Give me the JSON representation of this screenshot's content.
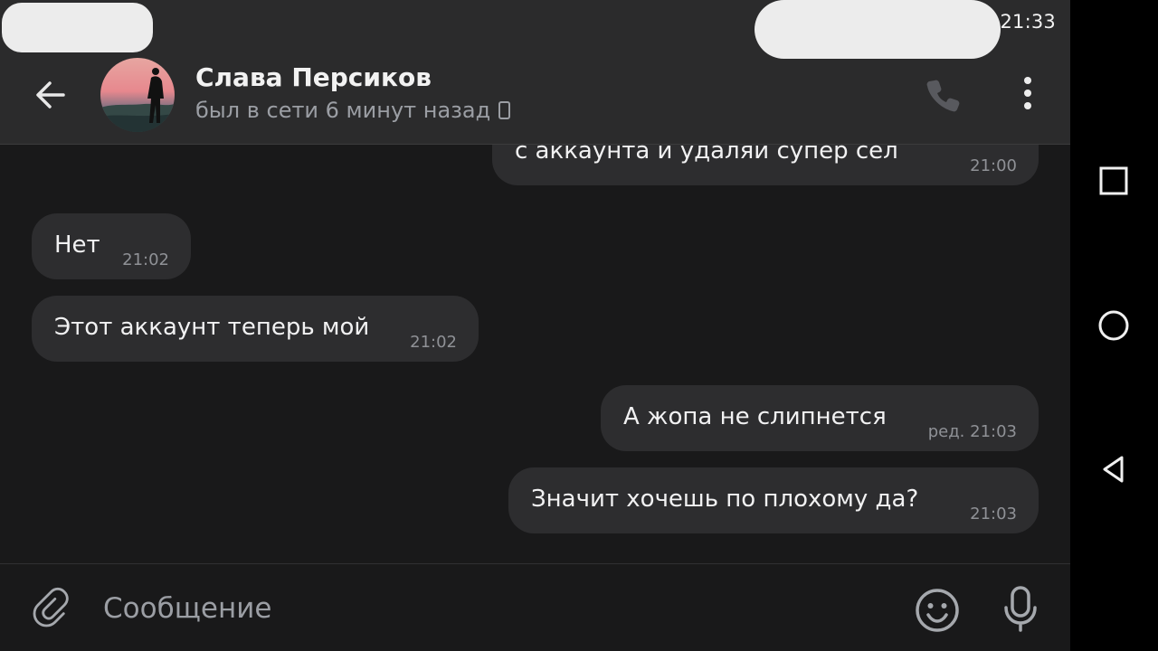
{
  "status_bar": {
    "time": "21:33"
  },
  "header": {
    "back_icon": "arrow-left-icon",
    "contact_name": "Слава Персиков",
    "last_seen": "был в сети 6 минут назад",
    "device_icon": "mobile-phone-icon",
    "call_icon": "phone-icon",
    "menu_icon": "more-vertical-icon"
  },
  "messages": [
    {
      "direction": "outgoing",
      "text": "с аккаунта и удаляй супер сел",
      "time": "21:00"
    },
    {
      "direction": "incoming",
      "text": "Нет",
      "time": "21:02"
    },
    {
      "direction": "incoming",
      "text": "Этот аккаунт теперь мой",
      "time": "21:02"
    },
    {
      "direction": "outgoing",
      "text": "А жопа не слипнется",
      "time": "ред. 21:03"
    },
    {
      "direction": "outgoing",
      "text": "Значит хочешь по плохому да?",
      "time": "21:03"
    }
  ],
  "composer": {
    "attach_icon": "paperclip-icon",
    "placeholder": "Сообщение",
    "value": "",
    "emoji_icon": "smile-icon",
    "mic_icon": "microphone-icon"
  },
  "navigation": {
    "recents_icon": "square-icon",
    "home_icon": "circle-icon",
    "back_icon": "triangle-back-icon"
  },
  "colors": {
    "header_background": "#2b2b2c",
    "chat_background": "#19191a",
    "bubble_background": "#2d2d2f",
    "secondary_text": "#9b9ea4"
  }
}
